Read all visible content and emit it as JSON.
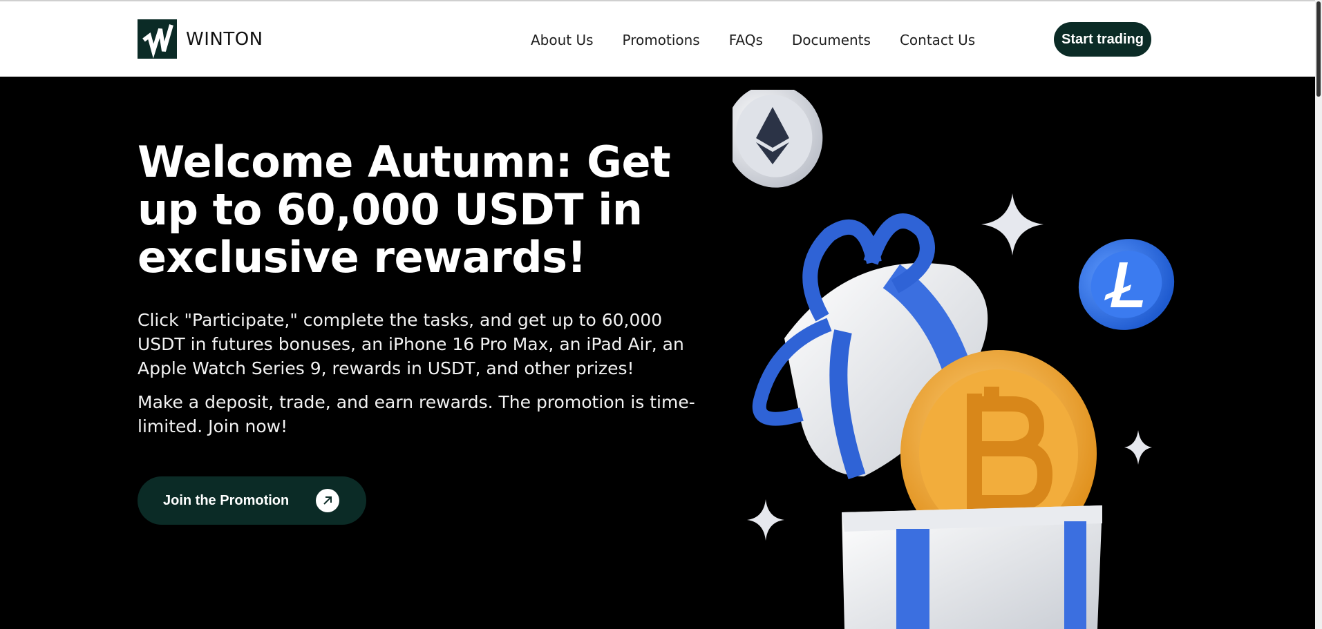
{
  "brand": {
    "name": "WINTON",
    "logo_icon": "w-mark-icon",
    "color": "#0b2b26"
  },
  "nav": {
    "items": [
      "About Us",
      "Promotions",
      "FAQs",
      "Documents",
      "Contact Us"
    ],
    "cta": "Start trading"
  },
  "hero": {
    "title": "Welcome Autumn: Get up to 60,000 USDT in exclusive rewards!",
    "paragraph1": "Click \"Participate,\" complete the tasks, and get up to 60,000 USDT in futures bonuses, an iPhone 16 Pro Max, an iPad Air, an Apple Watch Series 9, rewards in USDT, and other prizes!",
    "paragraph2": "Make a deposit, trade, and earn rewards. The promotion is time-limited. Join now!",
    "button": "Join the Promotion",
    "button_icon": "arrow-up-right-icon",
    "illustration_icons": [
      "ethereum-coin-icon",
      "litecoin-coin-icon",
      "bitcoin-coin-icon",
      "gift-box-icon",
      "sparkle-icon"
    ]
  },
  "colors": {
    "accent": "#0b2b26",
    "hero_bg": "#000000",
    "coin_blue": "#2f6fe0",
    "coin_gold": "#f0a92e"
  }
}
